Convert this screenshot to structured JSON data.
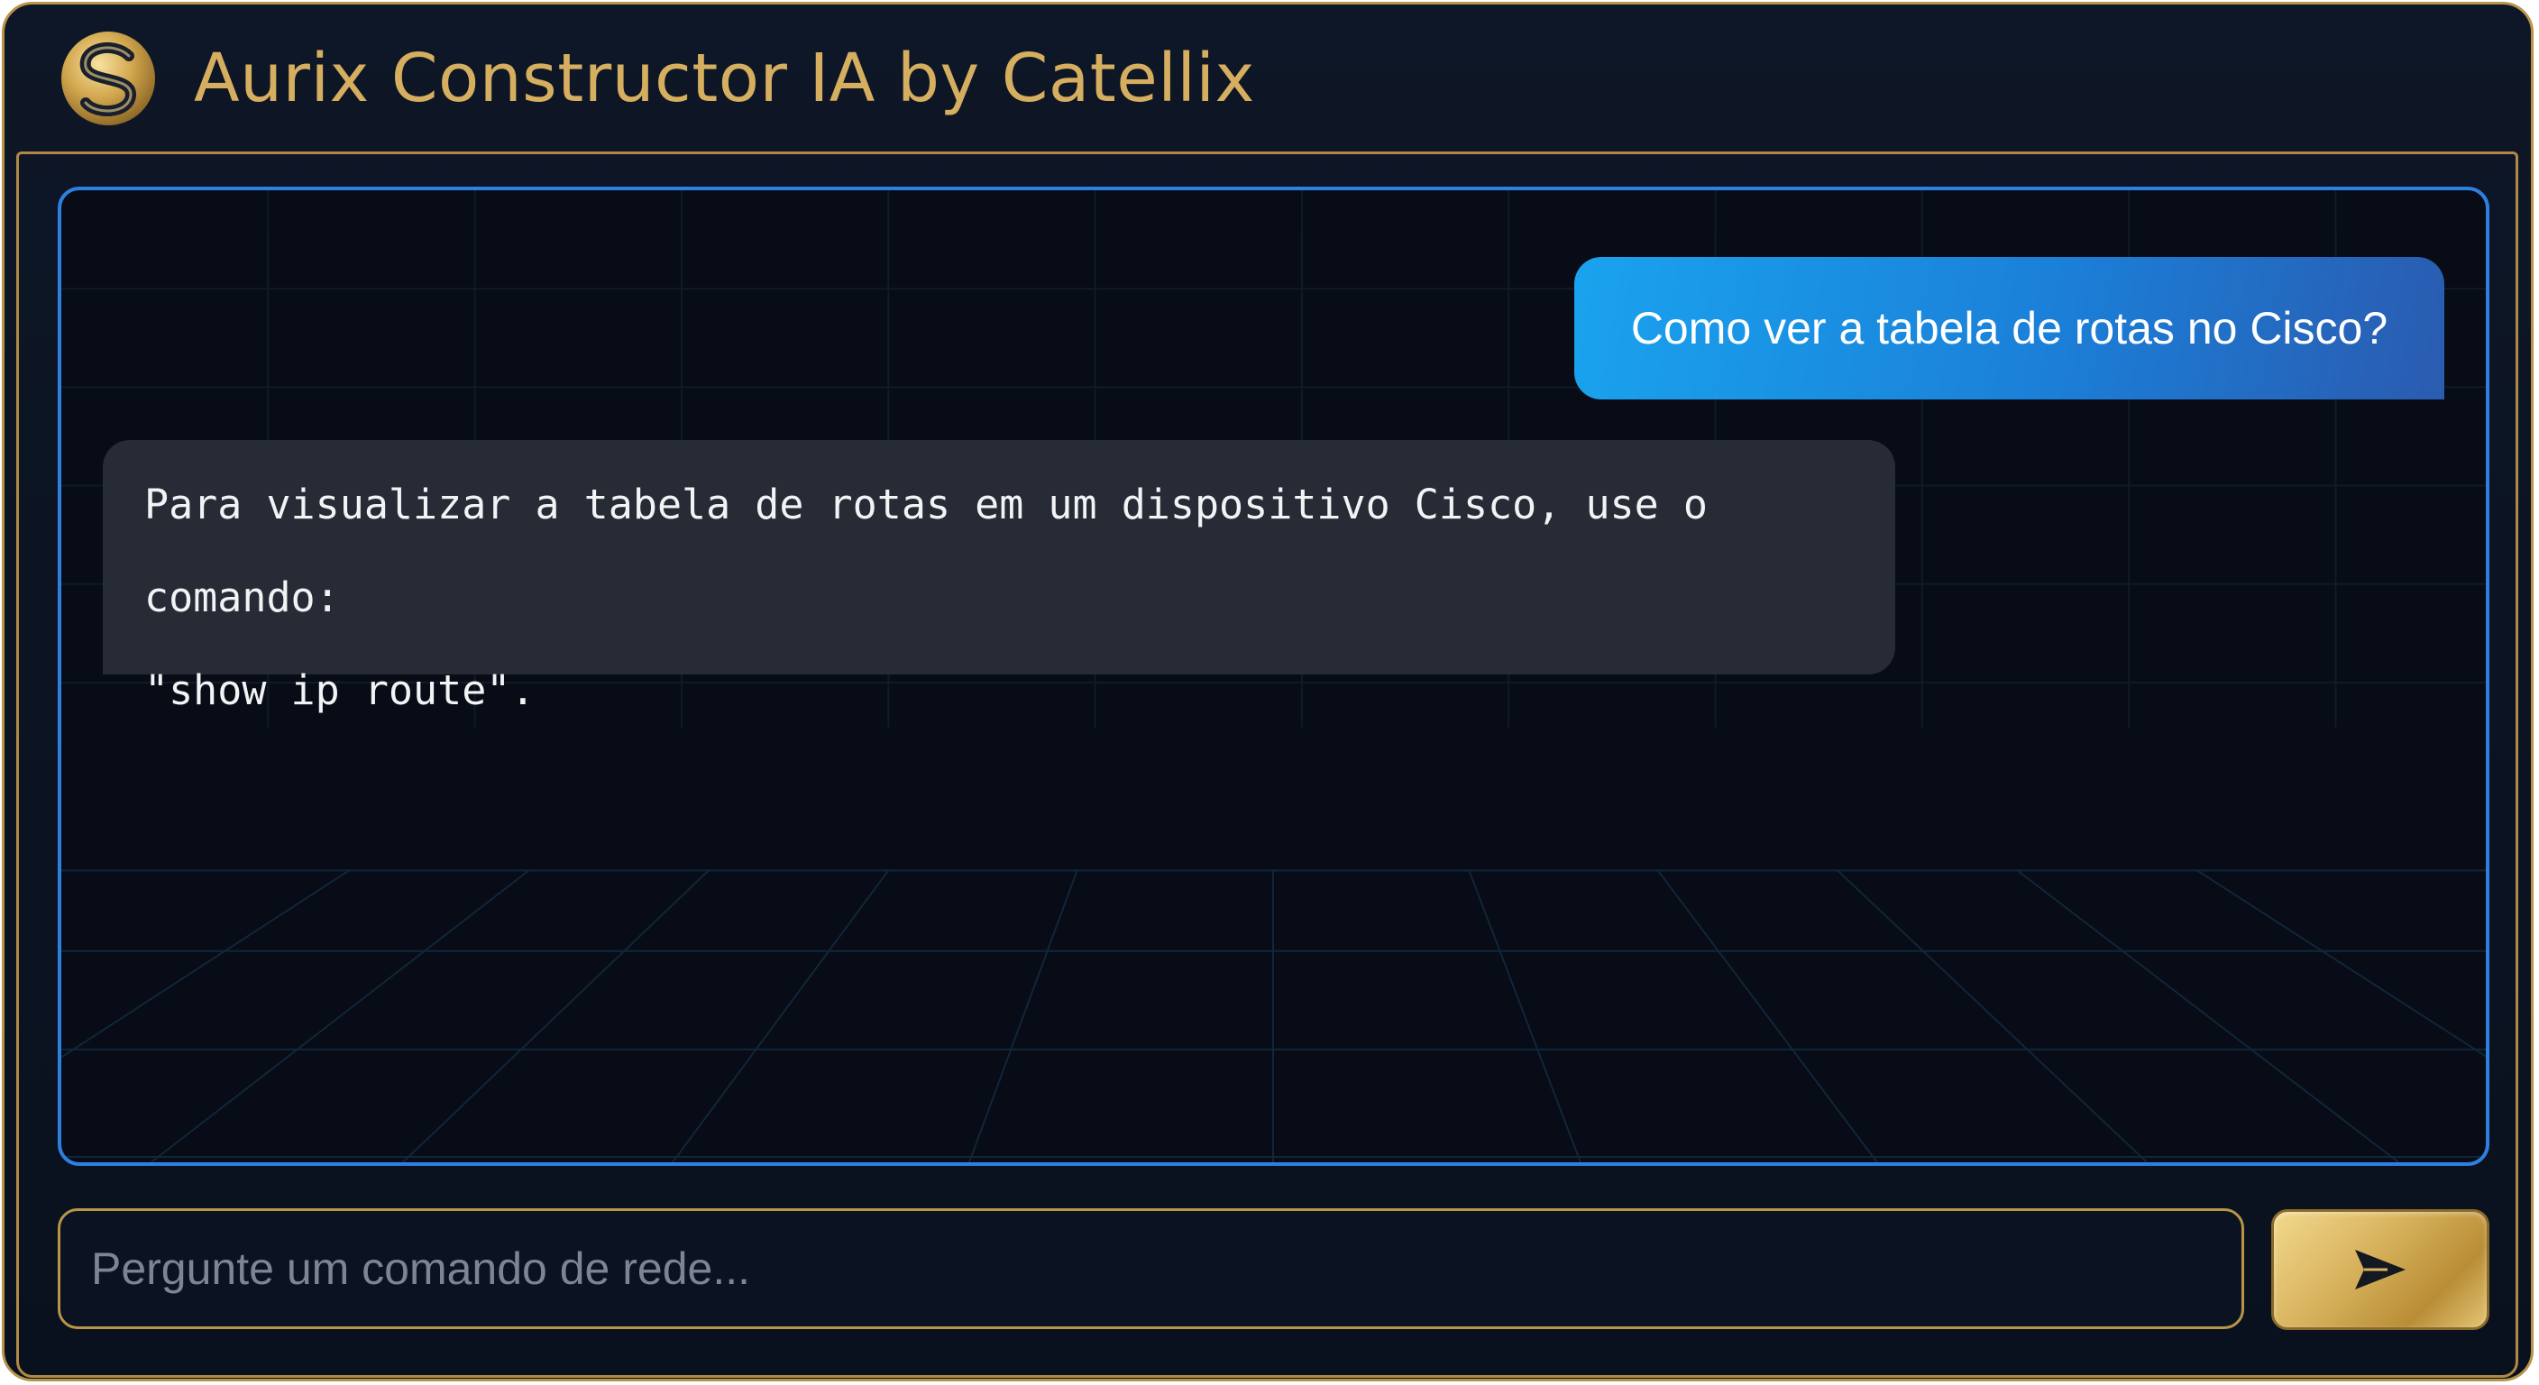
{
  "app": {
    "title": "Aurix Constructor IA by Catellix",
    "logo_icon": "gold-s-logo-icon",
    "accent_gold": "#d6ae5f",
    "accent_blue": "#2f7fe0"
  },
  "chat": {
    "messages": [
      {
        "role": "user",
        "text": "Como ver a tabela de rotas no Cisco?"
      },
      {
        "role": "assistant",
        "text": "Para visualizar a tabela de rotas em um dispositivo Cisco, use o comando:\n\"show ip route\"."
      }
    ]
  },
  "composer": {
    "placeholder": "Pergunte um comando de rede...",
    "value": "",
    "send_icon": "send-arrow-icon"
  }
}
